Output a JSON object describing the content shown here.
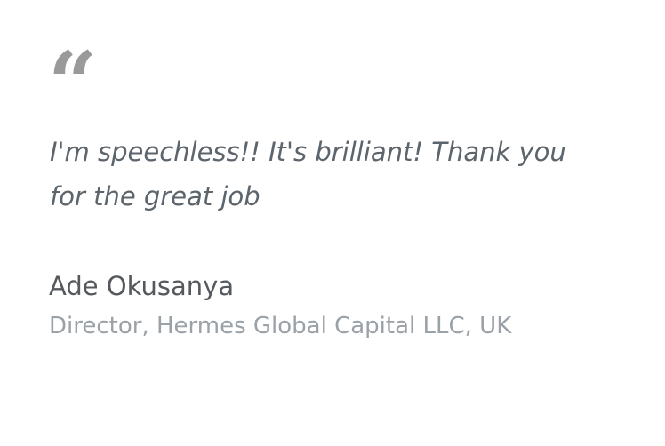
{
  "testimonial": {
    "quote_icon": "left-double-quote-icon",
    "quote_glyph": "“",
    "text": "I'm speechless!! It's brilliant! Thank you for the great job",
    "author_name": "Ade Okusanya",
    "author_title": "Director, Hermes Global Capital LLC, UK"
  },
  "colors": {
    "quote_mark": "#9a9a9a",
    "quote_text": "#5c646c",
    "author_name": "#55595d",
    "author_title": "#9aa1a7",
    "background": "#ffffff"
  }
}
